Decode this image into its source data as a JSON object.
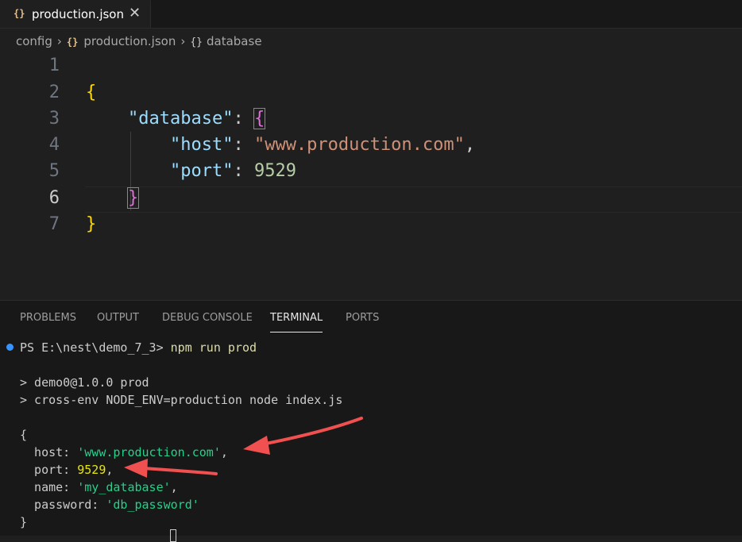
{
  "tab": {
    "icon": "json-icon",
    "title": "production.json",
    "close": "✕"
  },
  "breadcrumb": {
    "folder": "config",
    "file": "production.json",
    "symbol": "database",
    "sep": "›",
    "file_icon": "{}",
    "symbol_icon": "{}"
  },
  "editor": {
    "active_line": 6,
    "lines": [
      {
        "n": "1"
      },
      {
        "n": "2"
      },
      {
        "n": "3"
      },
      {
        "n": "4"
      },
      {
        "n": "5"
      },
      {
        "n": "6"
      },
      {
        "n": "7"
      }
    ],
    "code": {
      "l2_open": "{",
      "l3_indent": "    ",
      "l3_key": "\"database\"",
      "l3_colon": ": ",
      "l3_brace": "{",
      "l4_indent": "        ",
      "l4_key": "\"host\"",
      "l4_colon": ": ",
      "l4_val": "\"www.production.com\"",
      "l4_comma": ",",
      "l5_indent": "        ",
      "l5_key": "\"port\"",
      "l5_colon": ": ",
      "l5_val": "9529",
      "l6_indent": "    ",
      "l6_brace": "}",
      "l7_close": "}"
    }
  },
  "panel": {
    "tabs": [
      "PROBLEMS",
      "OUTPUT",
      "DEBUG CONSOLE",
      "TERMINAL",
      "PORTS"
    ],
    "active_tab": "TERMINAL"
  },
  "terminal": {
    "prompt": "PS E:\\nest\\demo_7_3> ",
    "command": "npm run prod",
    "run1": "> demo0@1.0.0 prod",
    "run2": "> cross-env NODE_ENV=production node index.js",
    "open": "{",
    "host_key": "  host: ",
    "host_val": "'www.production.com'",
    "host_comma": ",",
    "port_key": "  port: ",
    "port_val": "9529",
    "port_comma": ",",
    "name_key": "  name: ",
    "name_val": "'my_database'",
    "name_comma": ",",
    "pw_key": "  password: ",
    "pw_val": "'db_password'",
    "close": "}"
  },
  "colors": {
    "annotation_arrow": "#f0504f",
    "accent": "#3794ff"
  }
}
